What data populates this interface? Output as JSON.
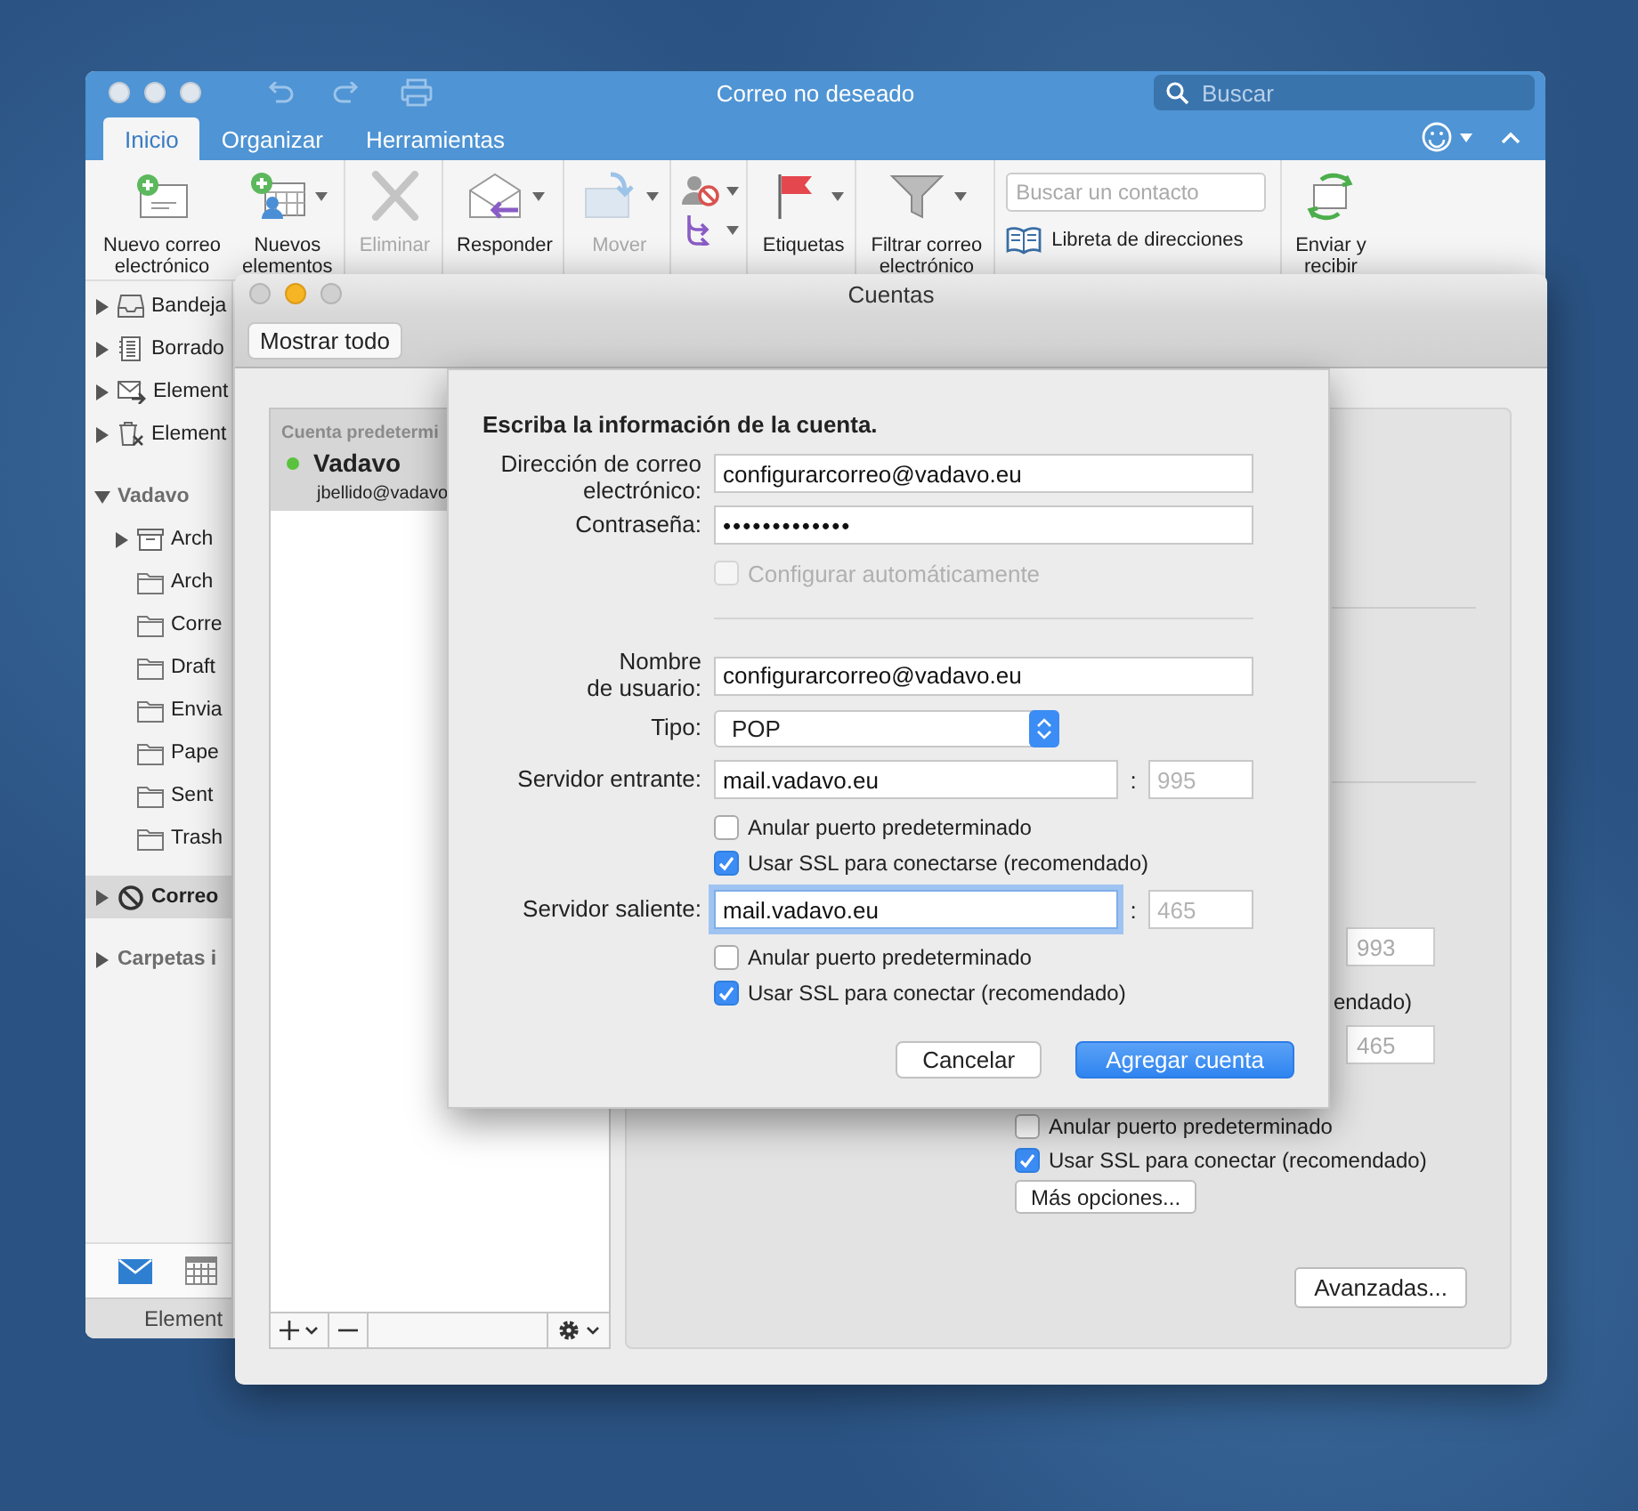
{
  "mail_window": {
    "title": "Correo no deseado",
    "search": {
      "placeholder": "Buscar"
    },
    "tabs": [
      {
        "label": "Inicio",
        "selected": true
      },
      {
        "label": "Organizar",
        "selected": false
      },
      {
        "label": "Herramientas",
        "selected": false
      }
    ],
    "ribbon": [
      {
        "kind": "new_mail",
        "label": "Nuevo correo\nelectrónico",
        "disabled": false
      },
      {
        "kind": "new_items",
        "label": "Nuevos\nelementos",
        "disabled": false,
        "caret": true
      },
      {
        "kind": "delete",
        "label": "Eliminar",
        "disabled": true
      },
      {
        "kind": "reply",
        "label": "Responder",
        "disabled": false,
        "caret": true
      },
      {
        "kind": "move",
        "label": "Mover",
        "disabled": true,
        "caret": true
      },
      {
        "kind": "junk_pair"
      },
      {
        "kind": "tag",
        "label": "Etiquetas",
        "disabled": false,
        "caret": true
      },
      {
        "kind": "filter",
        "label": "Filtrar correo\nelectrónico",
        "disabled": false,
        "caret": true
      },
      {
        "kind": "contacts",
        "placeholder": "Buscar un contacto",
        "link": "Libreta de direcciones"
      },
      {
        "kind": "send_receive",
        "label": "Enviar y\nrecibir",
        "disabled": false
      }
    ],
    "sidebar": {
      "items": [
        {
          "kind": "inbox",
          "label": "Bandeja",
          "expanded": false,
          "selected": false
        },
        {
          "kind": "drafts",
          "label": "Borrado",
          "expanded": false,
          "selected": false
        },
        {
          "kind": "sent",
          "label": "Element",
          "expanded": false,
          "selected": false
        },
        {
          "kind": "deleted",
          "label": "Element",
          "expanded": false,
          "selected": false
        },
        {
          "kind": "account",
          "label": "Vadavo",
          "expanded": true,
          "children": [
            {
              "kind": "archive",
              "label": "Arch",
              "expanded": false,
              "selected": false
            },
            {
              "kind": "folder",
              "label": "Arch",
              "selected": false
            },
            {
              "kind": "folder",
              "label": "Corre",
              "selected": false
            },
            {
              "kind": "folder",
              "label": "Draft",
              "selected": false
            },
            {
              "kind": "folder",
              "label": "Envia",
              "selected": false
            },
            {
              "kind": "folder",
              "label": "Pape",
              "selected": false
            },
            {
              "kind": "folder",
              "label": "Sent",
              "selected": false
            },
            {
              "kind": "folder",
              "label": "Trash",
              "selected": false
            }
          ]
        },
        {
          "kind": "junk",
          "label": "Correo",
          "expanded": false,
          "selected": true
        },
        {
          "kind": "account",
          "label": "Carpetas i",
          "expanded": false
        }
      ],
      "modules": [
        {
          "kind": "mail",
          "selected": true
        },
        {
          "kind": "calendar",
          "selected": false
        }
      ],
      "footer": "Element"
    }
  },
  "accounts_window": {
    "title": "Cuentas",
    "toolbar_button": "Mostrar todo",
    "accounts": [
      {
        "header": "Cuenta predetermi",
        "name": "Vadavo",
        "email": "jbellido@vadavo",
        "color": "#5ac23e",
        "selected": true
      }
    ],
    "pane": {
      "incoming_port": {
        "placeholder": "993"
      },
      "fragment": "endado)",
      "outgoing_port": {
        "placeholder": "465"
      },
      "options": [
        {
          "label": "Anular puerto predeterminado",
          "checked": false
        },
        {
          "label": "Usar SSL para conectar (recomendado)",
          "checked": true
        }
      ],
      "more_button": "Más opciones...",
      "advanced_button": "Avanzadas..."
    }
  },
  "sheet": {
    "heading": "Escriba la información de la cuenta.",
    "email": {
      "label": "Dirección de correo\nelectrónico:",
      "value": "configurarcorreo@vadavo.eu"
    },
    "password": {
      "label": "Contraseña:",
      "value": "•••••••••••••"
    },
    "auto_configure": {
      "label": "Configurar automáticamente",
      "checked": false,
      "disabled": true
    },
    "username": {
      "label": "Nombre\nde usuario:",
      "value": "configurarcorreo@vadavo.eu"
    },
    "type": {
      "label": "Tipo:",
      "value": "POP"
    },
    "servers": [
      {
        "label": "Servidor entrante:",
        "value": "mail.vadavo.eu",
        "focused": false,
        "port_separator": ":",
        "port_placeholder": "995",
        "options": [
          {
            "label": "Anular puerto predeterminado",
            "checked": false
          },
          {
            "label": "Usar SSL para conectarse (recomendado)",
            "checked": true
          }
        ]
      },
      {
        "label": "Servidor saliente:",
        "value": "mail.vadavo.eu",
        "focused": true,
        "port_separator": ":",
        "port_placeholder": "465",
        "options": [
          {
            "label": "Anular puerto predeterminado",
            "checked": false
          },
          {
            "label": "Usar SSL para conectar (recomendado)",
            "checked": true
          }
        ]
      }
    ],
    "buttons": [
      {
        "label": "Cancelar",
        "primary": false
      },
      {
        "label": "Agregar cuenta",
        "primary": true
      }
    ]
  }
}
